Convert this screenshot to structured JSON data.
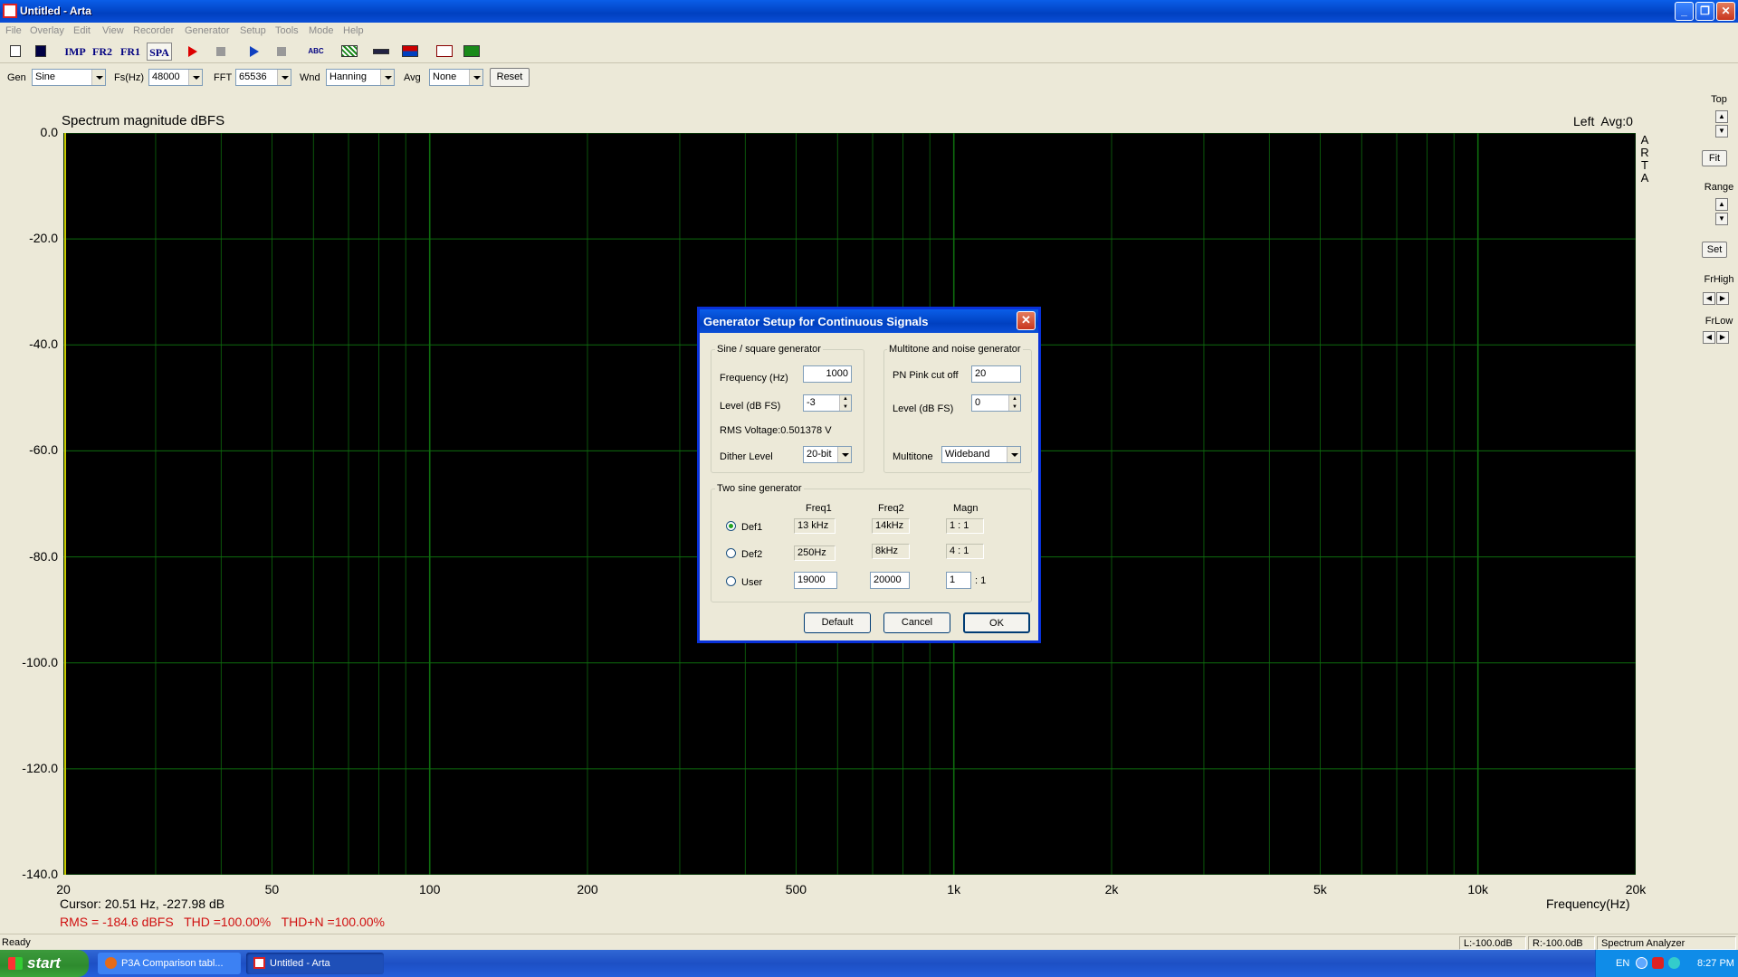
{
  "window": {
    "title": "Untitled - Arta",
    "min": "_",
    "restore": "❐",
    "close": "✕"
  },
  "menu": [
    "File",
    "Overlay",
    "Edit",
    "View",
    "Recorder",
    "Generator",
    "Setup",
    "Tools",
    "Mode",
    "Help"
  ],
  "toolbar": {
    "imp": "IMP",
    "fr2": "FR2",
    "fr1": "FR1",
    "spa": "SPA",
    "abc": "ABC"
  },
  "params": {
    "gen_label": "Gen",
    "gen_value": "Sine",
    "fs_label": "Fs(Hz)",
    "fs_value": "48000",
    "fft_label": "FFT",
    "fft_value": "65536",
    "wnd_label": "Wnd",
    "wnd_value": "Hanning",
    "avg_label": "Avg",
    "avg_value": "None",
    "reset_label": "Reset"
  },
  "plot": {
    "title": "Spectrum magnitude dBFS",
    "status_right": "Left  Avg:0",
    "arta_vertical": [
      "A",
      "R",
      "T",
      "A"
    ],
    "cursor": "Cursor: 20.51 Hz, -227.98 dB",
    "metrics": "RMS = -184.6 dBFS   THD =100.00%   THD+N =100.00%",
    "xlabel": "Frequency(Hz)",
    "y_ticks": [
      "0.0",
      "-20.0",
      "-40.0",
      "-60.0",
      "-80.0",
      "-100.0",
      "-120.0",
      "-140.0"
    ],
    "x_ticks": [
      "20",
      "50",
      "100",
      "200",
      "500",
      "1k",
      "2k",
      "5k",
      "10k",
      "20k"
    ],
    "grid_color": "#0e6b0e",
    "axis_color": "#c8c800"
  },
  "right_panel": {
    "top": "Top",
    "fit": "Fit",
    "range": "Range",
    "set": "Set",
    "frhigh": "FrHigh",
    "frlow": "FrLow"
  },
  "status": {
    "left": "Ready",
    "l": "L:-100.0dB",
    "r": "R:-100.0dB",
    "mode": "Spectrum Analyzer"
  },
  "taskbar": {
    "start": "start",
    "tasks": [
      "P3A Comparison tabl...",
      "Untitled - Arta"
    ],
    "lang": "EN",
    "clock": "8:27 PM"
  },
  "dialog": {
    "title": "Generator Setup for Continuous Signals",
    "sine": {
      "group": "Sine / square generator",
      "freq_label": "Frequency (Hz)",
      "freq_value": "1000",
      "level_label": "Level (dB FS)",
      "level_value": "-3",
      "rms": "RMS Voltage:0.501378 V",
      "dither_label": "Dither Level",
      "dither_value": "20-bit"
    },
    "multitone": {
      "group": "Multitone and noise generator",
      "pn_label": "PN Pink cut off",
      "pn_value": "20",
      "level_label": "Level (dB FS)",
      "level_value": "0",
      "mt_label": "Multitone",
      "mt_value": "Wideband"
    },
    "twosine": {
      "group": "Two sine generator",
      "col_freq1": "Freq1",
      "col_freq2": "Freq2",
      "col_magn": "Magn",
      "rows": [
        {
          "label": "Def1",
          "f1": "13 kHz",
          "f2": "14kHz",
          "magn": "1 : 1",
          "selected": true
        },
        {
          "label": "Def2",
          "f1": "250Hz",
          "f2": "8kHz",
          "magn": "4 : 1",
          "selected": false
        }
      ],
      "user": {
        "label": "User",
        "f1": "19000",
        "f2": "20000",
        "magn": "1",
        "magn_suffix": ": 1"
      }
    },
    "buttons": {
      "default": "Default",
      "cancel": "Cancel",
      "ok": "OK"
    }
  }
}
